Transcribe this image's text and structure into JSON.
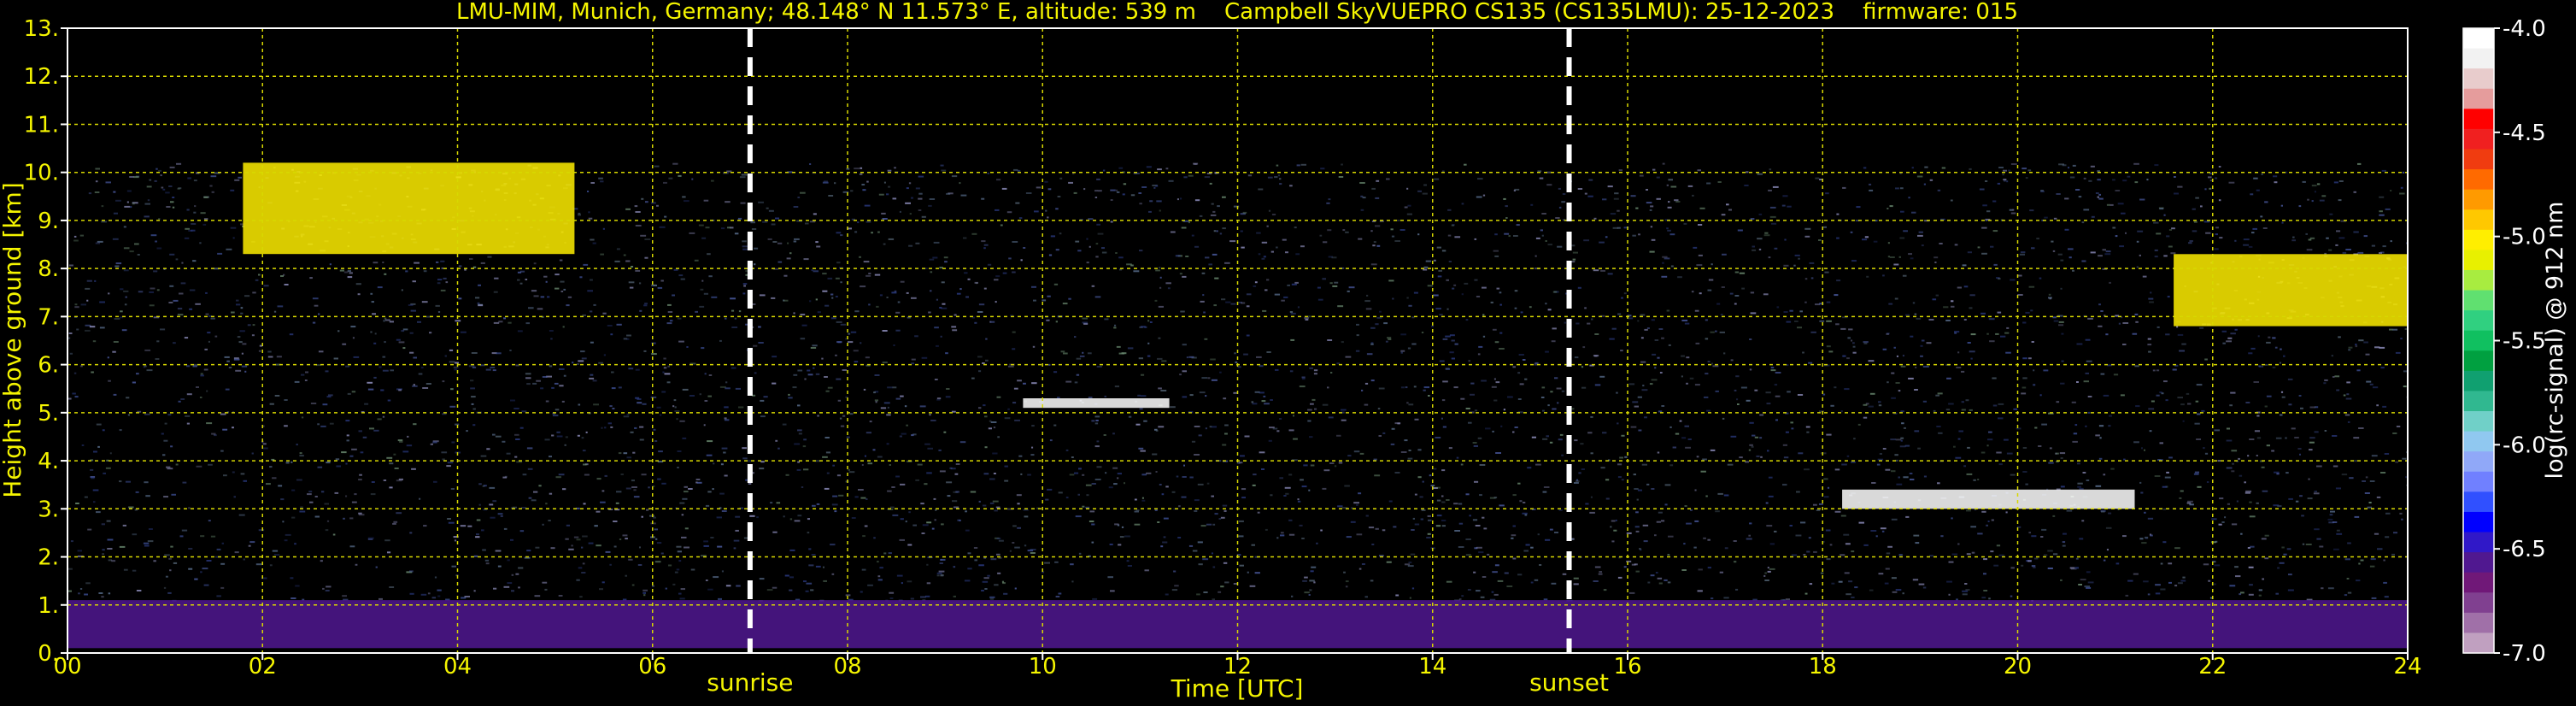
{
  "chart_data": {
    "type": "heatmap",
    "title": "LMU-MIM, Munich, Germany; 48.148° N 11.573° E, altitude: 539 m    Campbell SkyVUEPRO CS135 (CS135LMU): 25-12-2023    firmware: 015",
    "xlabel": "Time [UTC]",
    "ylabel": "Height above ground [km]",
    "xlim": [
      0,
      24
    ],
    "ylim": [
      0,
      13
    ],
    "x_ticks": [
      "00",
      "02",
      "04",
      "06",
      "08",
      "10",
      "12",
      "14",
      "16",
      "18",
      "20",
      "22",
      "24"
    ],
    "y_ticks": [
      "0.",
      "1.",
      "2.",
      "3.",
      "4.",
      "5.",
      "6.",
      "7.",
      "8.",
      "9.",
      "10.",
      "11.",
      "12.",
      "13."
    ],
    "grid": true,
    "colorbar": {
      "label": "log(rc-signal) @ 912 nm",
      "min": -7.0,
      "max": -4.0,
      "ticks": [
        "-4.0",
        "-4.5",
        "-5.0",
        "-5.5",
        "-6.0",
        "-6.5",
        "-7.0"
      ],
      "colors": [
        "#ffffff",
        "#f2f2f2",
        "#e8cccc",
        "#e59c9c",
        "#ff0000",
        "#f02020",
        "#f03c10",
        "#ff6a00",
        "#ff9a00",
        "#ffc800",
        "#ffee00",
        "#e8f000",
        "#a8ec40",
        "#60e070",
        "#30d080",
        "#10c060",
        "#00a040",
        "#10a070",
        "#30b890",
        "#70d0c8",
        "#90c8f0",
        "#90a8f8",
        "#7080ff",
        "#3050ff",
        "#0000ff",
        "#3018c8",
        "#501890",
        "#701878",
        "#804090",
        "#a070a8",
        "#c0a0c0"
      ]
    },
    "vlines": [
      {
        "label": "sunrise",
        "x": 7.0
      },
      {
        "label": "sunset",
        "x": 15.4
      }
    ],
    "features": [
      {
        "x": [
          0,
          24
        ],
        "y": [
          0.1,
          1.1
        ],
        "value": -6.6
      },
      {
        "x": [
          1.8,
          5.2
        ],
        "y": [
          8.3,
          10.2
        ],
        "value": -5.0
      },
      {
        "x": [
          9.8,
          11.3
        ],
        "y": [
          5.1,
          5.3
        ],
        "value": -4.0
      },
      {
        "x": [
          18.2,
          21.2
        ],
        "y": [
          3.0,
          3.4
        ],
        "value": -4.0
      },
      {
        "x": [
          21.6,
          24
        ],
        "y": [
          6.8,
          8.3
        ],
        "value": -5.0
      }
    ]
  }
}
